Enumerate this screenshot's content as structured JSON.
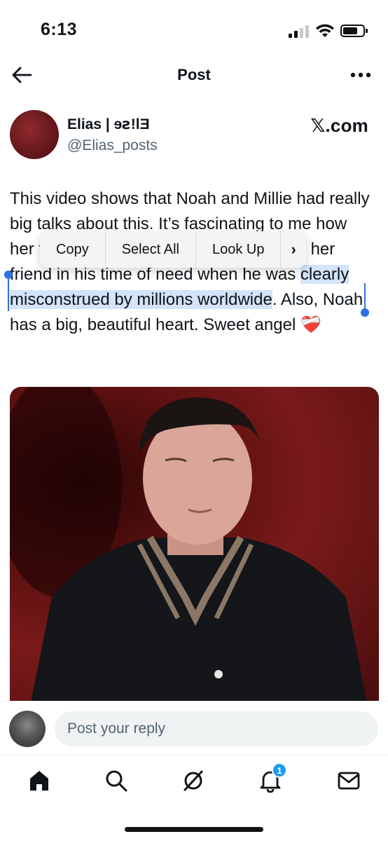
{
  "status_bar": {
    "time": "6:13"
  },
  "nav": {
    "title": "Post"
  },
  "author": {
    "name": "Elias | ɘꙅ!lƎ",
    "handle": "@Elias_posts",
    "site": "𝕏.com"
  },
  "post": {
    "text_before": "This video shows that Noah and Millie had really big talks about this. It’s fascinating to me how her friend stood by him and looked after her friend in his time of need when he was ",
    "text_selected": "clearly misconstrued by millions worldwide",
    "text_after": ". Also, Noah has a big, beautiful heart. Sweet angel ❤️‍🩹"
  },
  "context_menu": {
    "items": [
      "Copy",
      "Select All",
      "Look Up"
    ],
    "more_label": "›"
  },
  "reply": {
    "placeholder": "Post your reply"
  },
  "tabbar": {
    "notification_count": "1"
  },
  "colors": {
    "accent": "#1d9bf0",
    "selection": "#d3e3f8",
    "handle": "#2f6fe0"
  }
}
